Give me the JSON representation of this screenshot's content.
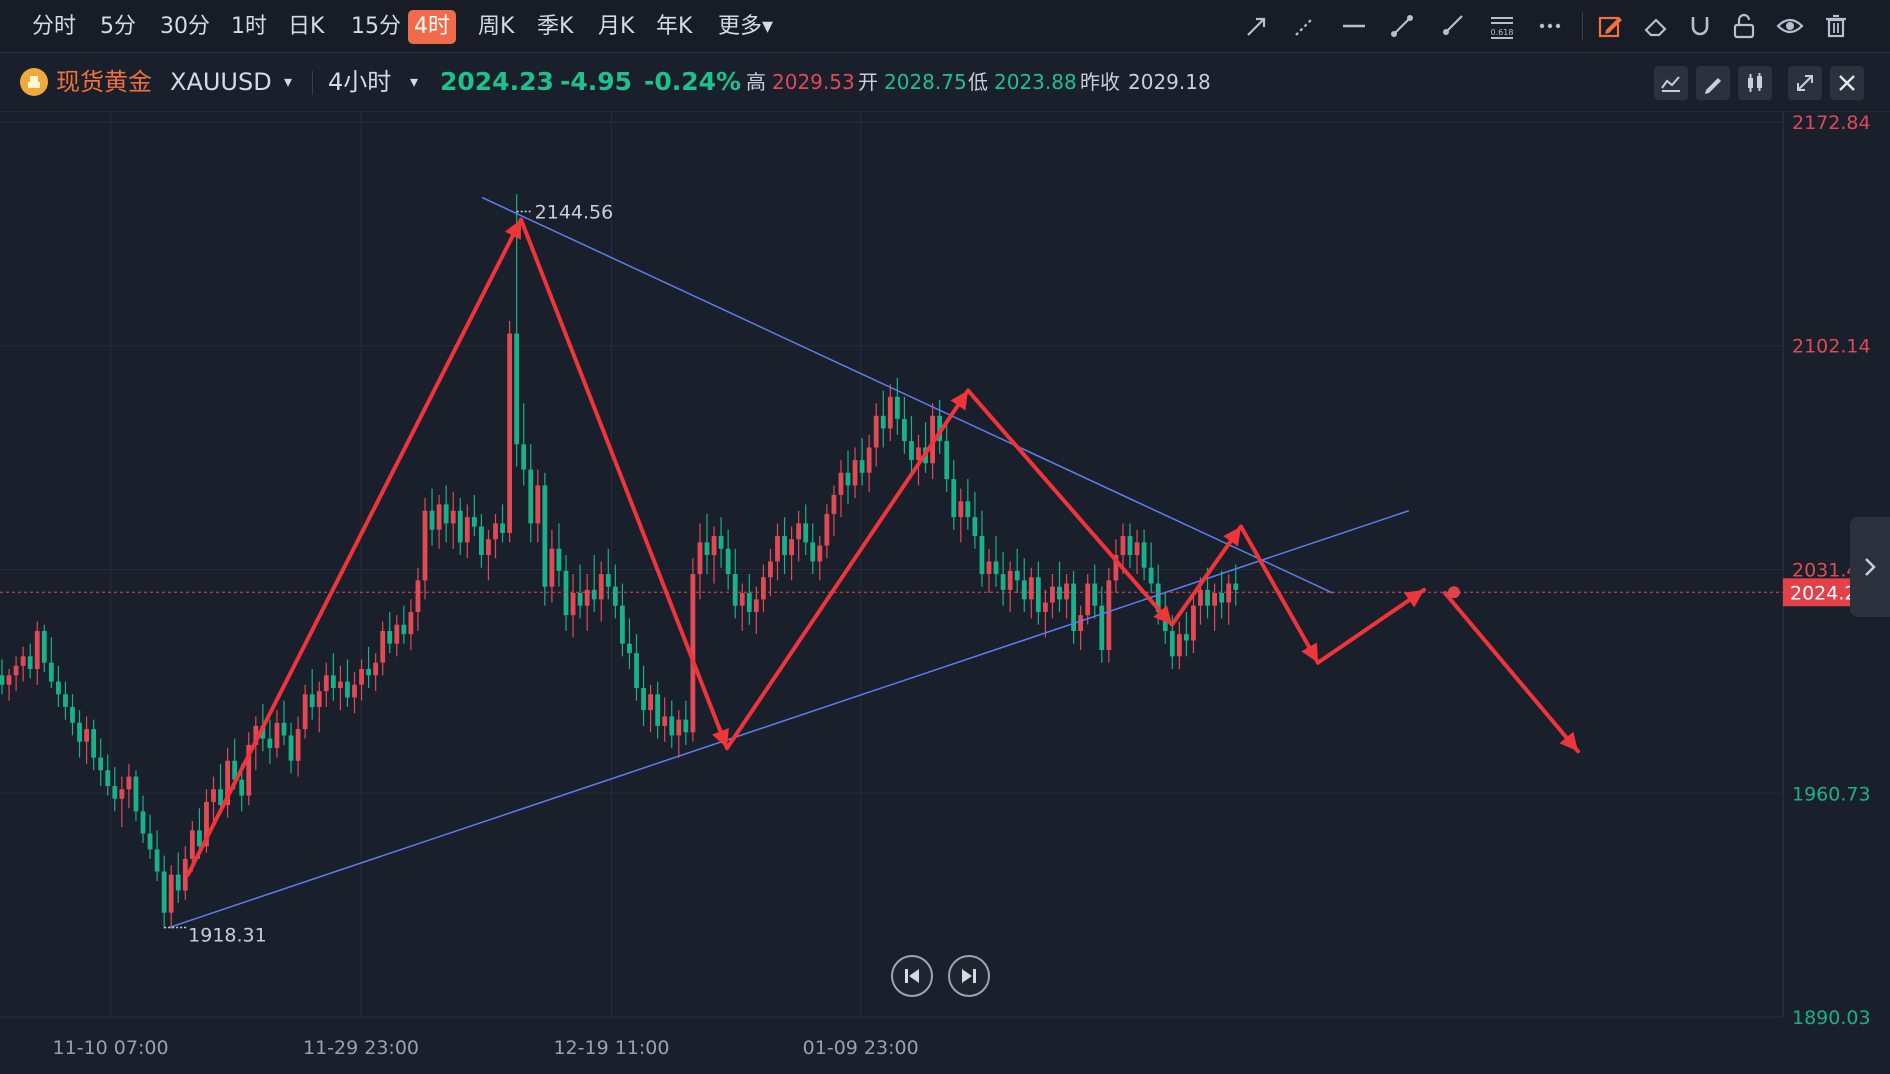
{
  "timeframes": [
    "分时",
    "5分",
    "30分",
    "1时",
    "日K",
    "15分",
    "4时",
    "周K",
    "季K",
    "月K",
    "年K",
    "更多"
  ],
  "active_timeframe": "4时",
  "tool_icons": [
    "arrow-line-icon",
    "dashed-line-icon",
    "horizontal-line-icon",
    "segment-icon",
    "ray-icon",
    "fibonacci-icon",
    "more-dots-icon",
    "edit-icon",
    "eraser-icon",
    "magnet-icon",
    "unlock-icon",
    "eye-icon",
    "trash-icon"
  ],
  "instrument": {
    "name": "现货黄金",
    "symbol": "XAUUSD",
    "period": "4小时",
    "price": "2024.23",
    "change": "-4.95",
    "change_pct": "-0.24%",
    "high_label": "高",
    "high": "2029.53",
    "open_label": "开",
    "open": "2028.75",
    "low_label": "低",
    "low": "2023.88",
    "prev_label": "昨收",
    "prev": "2029.18"
  },
  "colors": {
    "up": "#e04a55",
    "down": "#19b08a",
    "price_green": "#20c08a",
    "arrow": "#f0353a",
    "trendline": "#5d7ef0",
    "bg": "#1a1f2c",
    "grid": "#262c39"
  },
  "chart_data": {
    "type": "candlestick",
    "symbol": "XAUUSD",
    "timeframe": "4H",
    "y_ticks": [
      2172.84,
      2102.14,
      2031.44,
      1960.73,
      1890.03
    ],
    "y_tick_labels": [
      "2172.84",
      "2102.14",
      "2031.44",
      "1960.73",
      "1890.03"
    ],
    "ylim": [
      1890.03,
      2172.84
    ],
    "x_tick_labels": [
      "11-10 07:00",
      "11-29 23:00",
      "12-19 11:00",
      "01-09 23:00"
    ],
    "current_price": 2024.23,
    "current_price_label": "2024.23",
    "annotations": [
      {
        "label": "2144.56",
        "value": 2144.56
      },
      {
        "label": "1918.31",
        "value": 1918.31
      }
    ],
    "trendlines": [
      {
        "name": "upper-resistance",
        "from": [
          0.0,
          2149
        ],
        "to": [
          1.0,
          2024
        ]
      },
      {
        "name": "lower-support",
        "from": [
          0.0,
          1918.3
        ],
        "to": [
          1.0,
          2050
        ]
      }
    ],
    "swing_path": [
      2142,
      1975,
      2088,
      2014,
      2045,
      2002,
      2025
    ],
    "projection": {
      "from": 2024,
      "to": 1974
    },
    "candles": [
      [
        1998,
        2003,
        1992,
        1995
      ],
      [
        1995,
        2000,
        1990,
        1998
      ],
      [
        1998,
        2004,
        1993,
        2001
      ],
      [
        2001,
        2007,
        1996,
        2004
      ],
      [
        2004,
        2008,
        1997,
        2000
      ],
      [
        2000,
        2015,
        1995,
        2012
      ],
      [
        2012,
        2014,
        1999,
        2002
      ],
      [
        2002,
        2010,
        1994,
        1996
      ],
      [
        1996,
        2001,
        1988,
        1992
      ],
      [
        1992,
        1996,
        1984,
        1988
      ],
      [
        1988,
        1992,
        1979,
        1983
      ],
      [
        1983,
        1987,
        1972,
        1977
      ],
      [
        1977,
        1985,
        1970,
        1981
      ],
      [
        1981,
        1984,
        1968,
        1972
      ],
      [
        1972,
        1978,
        1963,
        1968
      ],
      [
        1968,
        1973,
        1960,
        1963
      ],
      [
        1963,
        1969,
        1955,
        1959
      ],
      [
        1959,
        1966,
        1950,
        1962
      ],
      [
        1962,
        1970,
        1956,
        1966
      ],
      [
        1966,
        1968,
        1952,
        1955
      ],
      [
        1955,
        1960,
        1945,
        1948
      ],
      [
        1948,
        1954,
        1940,
        1943
      ],
      [
        1943,
        1949,
        1933,
        1936
      ],
      [
        1936,
        1941,
        1918,
        1923
      ],
      [
        1923,
        1938,
        1918,
        1935
      ],
      [
        1935,
        1942,
        1926,
        1930
      ],
      [
        1930,
        1944,
        1927,
        1940
      ],
      [
        1940,
        1952,
        1936,
        1949
      ],
      [
        1949,
        1956,
        1940,
        1944
      ],
      [
        1944,
        1962,
        1942,
        1958
      ],
      [
        1958,
        1966,
        1952,
        1962
      ],
      [
        1962,
        1970,
        1955,
        1957
      ],
      [
        1957,
        1975,
        1953,
        1971
      ],
      [
        1971,
        1978,
        1962,
        1965
      ],
      [
        1965,
        1970,
        1955,
        1960
      ],
      [
        1960,
        1980,
        1957,
        1976
      ],
      [
        1976,
        1985,
        1968,
        1982
      ],
      [
        1982,
        1989,
        1974,
        1978
      ],
      [
        1978,
        1984,
        1970,
        1975
      ],
      [
        1975,
        1987,
        1972,
        1983
      ],
      [
        1983,
        1990,
        1976,
        1979
      ],
      [
        1979,
        1983,
        1967,
        1971
      ],
      [
        1971,
        1985,
        1966,
        1981
      ],
      [
        1981,
        1995,
        1978,
        1992
      ],
      [
        1992,
        2000,
        1984,
        1988
      ],
      [
        1988,
        1996,
        1980,
        1993
      ],
      [
        1993,
        2002,
        1988,
        1998
      ],
      [
        1998,
        2005,
        1990,
        1994
      ],
      [
        1994,
        2001,
        1987,
        1996
      ],
      [
        1996,
        2003,
        1988,
        1991
      ],
      [
        1991,
        1999,
        1986,
        1995
      ],
      [
        1995,
        2003,
        1990,
        2000
      ],
      [
        2000,
        2007,
        1994,
        1998
      ],
      [
        1998,
        2005,
        1993,
        2002
      ],
      [
        2002,
        2015,
        1998,
        2012
      ],
      [
        2012,
        2018,
        2005,
        2008
      ],
      [
        2008,
        2017,
        2004,
        2014
      ],
      [
        2014,
        2020,
        2008,
        2011
      ],
      [
        2011,
        2022,
        2006,
        2018
      ],
      [
        2018,
        2032,
        2012,
        2028
      ],
      [
        2028,
        2054,
        2022,
        2050
      ],
      [
        2050,
        2057,
        2039,
        2044
      ],
      [
        2044,
        2055,
        2038,
        2052
      ],
      [
        2052,
        2058,
        2040,
        2046
      ],
      [
        2046,
        2056,
        2038,
        2050
      ],
      [
        2050,
        2054,
        2036,
        2040
      ],
      [
        2040,
        2052,
        2035,
        2048
      ],
      [
        2048,
        2055,
        2042,
        2045
      ],
      [
        2045,
        2049,
        2032,
        2036
      ],
      [
        2036,
        2044,
        2028,
        2041
      ],
      [
        2041,
        2049,
        2035,
        2046
      ],
      [
        2046,
        2052,
        2040,
        2043
      ],
      [
        2043,
        2110,
        2040,
        2106
      ],
      [
        2106,
        2150,
        2064,
        2071
      ],
      [
        2071,
        2084,
        2058,
        2063
      ],
      [
        2063,
        2071,
        2040,
        2046
      ],
      [
        2046,
        2063,
        2040,
        2058
      ],
      [
        2058,
        2062,
        2020,
        2026
      ],
      [
        2026,
        2044,
        2021,
        2038
      ],
      [
        2038,
        2046,
        2026,
        2031
      ],
      [
        2031,
        2036,
        2012,
        2017
      ],
      [
        2017,
        2030,
        2010,
        2024
      ],
      [
        2024,
        2033,
        2016,
        2020
      ],
      [
        2020,
        2030,
        2012,
        2025
      ],
      [
        2025,
        2036,
        2018,
        2022
      ],
      [
        2022,
        2034,
        2015,
        2030
      ],
      [
        2030,
        2038,
        2022,
        2026
      ],
      [
        2026,
        2033,
        2016,
        2020
      ],
      [
        2020,
        2027,
        2004,
        2008
      ],
      [
        2008,
        2016,
        2000,
        2005
      ],
      [
        2005,
        2011,
        1990,
        1994
      ],
      [
        1994,
        2001,
        1982,
        1987
      ],
      [
        1987,
        1995,
        1980,
        1992
      ],
      [
        1992,
        1996,
        1978,
        1982
      ],
      [
        1982,
        1991,
        1977,
        1985
      ],
      [
        1985,
        1990,
        1975,
        1979
      ],
      [
        1979,
        1987,
        1972,
        1984
      ],
      [
        1984,
        1990,
        1976,
        1980
      ],
      [
        1980,
        2035,
        1977,
        2030
      ],
      [
        2030,
        2046,
        2022,
        2040
      ],
      [
        2040,
        2049,
        2030,
        2036
      ],
      [
        2036,
        2045,
        2027,
        2042
      ],
      [
        2042,
        2048,
        2032,
        2038
      ],
      [
        2038,
        2044,
        2025,
        2030
      ],
      [
        2030,
        2038,
        2016,
        2020
      ],
      [
        2020,
        2027,
        2012,
        2024
      ],
      [
        2024,
        2030,
        2014,
        2018
      ],
      [
        2018,
        2026,
        2011,
        2022
      ],
      [
        2022,
        2033,
        2018,
        2029
      ],
      [
        2029,
        2038,
        2023,
        2034
      ],
      [
        2034,
        2046,
        2028,
        2042
      ],
      [
        2042,
        2048,
        2030,
        2036
      ],
      [
        2036,
        2045,
        2028,
        2041
      ],
      [
        2041,
        2050,
        2034,
        2046
      ],
      [
        2046,
        2052,
        2036,
        2040
      ],
      [
        2040,
        2046,
        2030,
        2034
      ],
      [
        2034,
        2042,
        2028,
        2039
      ],
      [
        2039,
        2052,
        2035,
        2049
      ],
      [
        2049,
        2058,
        2042,
        2055
      ],
      [
        2055,
        2066,
        2048,
        2062
      ],
      [
        2062,
        2069,
        2052,
        2058
      ],
      [
        2058,
        2070,
        2054,
        2066
      ],
      [
        2066,
        2073,
        2058,
        2062
      ],
      [
        2062,
        2074,
        2056,
        2070
      ],
      [
        2070,
        2084,
        2064,
        2080
      ],
      [
        2080,
        2088,
        2070,
        2076
      ],
      [
        2076,
        2090,
        2072,
        2086
      ],
      [
        2086,
        2092,
        2074,
        2079
      ],
      [
        2079,
        2086,
        2068,
        2072
      ],
      [
        2072,
        2080,
        2062,
        2066
      ],
      [
        2066,
        2074,
        2058,
        2070
      ],
      [
        2070,
        2078,
        2062,
        2065
      ],
      [
        2065,
        2084,
        2060,
        2080
      ],
      [
        2080,
        2085,
        2068,
        2072
      ],
      [
        2072,
        2079,
        2056,
        2060
      ],
      [
        2060,
        2066,
        2044,
        2048
      ],
      [
        2048,
        2057,
        2040,
        2053
      ],
      [
        2053,
        2060,
        2044,
        2048
      ],
      [
        2048,
        2056,
        2038,
        2042
      ],
      [
        2042,
        2050,
        2026,
        2030
      ],
      [
        2030,
        2038,
        2024,
        2034
      ],
      [
        2034,
        2042,
        2026,
        2030
      ],
      [
        2030,
        2037,
        2020,
        2025
      ],
      [
        2025,
        2034,
        2018,
        2031
      ],
      [
        2031,
        2038,
        2024,
        2028
      ],
      [
        2028,
        2035,
        2018,
        2022
      ],
      [
        2022,
        2032,
        2016,
        2029
      ],
      [
        2029,
        2034,
        2014,
        2018
      ],
      [
        2018,
        2025,
        2010,
        2021
      ],
      [
        2021,
        2030,
        2016,
        2026
      ],
      [
        2026,
        2034,
        2018,
        2022
      ],
      [
        2022,
        2030,
        2016,
        2027
      ],
      [
        2027,
        2031,
        2008,
        2012
      ],
      [
        2012,
        2020,
        2006,
        2017
      ],
      [
        2017,
        2030,
        2014,
        2027
      ],
      [
        2027,
        2033,
        2016,
        2020
      ],
      [
        2020,
        2026,
        2002,
        2006
      ],
      [
        2006,
        2032,
        2002,
        2028
      ],
      [
        2028,
        2041,
        2024,
        2036
      ],
      [
        2036,
        2046,
        2030,
        2042
      ],
      [
        2042,
        2046,
        2032,
        2036
      ],
      [
        2036,
        2044,
        2030,
        2040
      ],
      [
        2040,
        2044,
        2028,
        2032
      ],
      [
        2032,
        2040,
        2024,
        2027
      ],
      [
        2027,
        2033,
        2014,
        2018
      ],
      [
        2018,
        2024,
        2008,
        2012
      ],
      [
        2012,
        2017,
        2000,
        2004
      ],
      [
        2004,
        2015,
        2000,
        2011
      ],
      [
        2011,
        2018,
        2004,
        2009
      ],
      [
        2009,
        2023,
        2005,
        2020
      ],
      [
        2020,
        2029,
        2014,
        2025
      ],
      [
        2025,
        2032,
        2016,
        2020
      ],
      [
        2020,
        2027,
        2012,
        2024
      ],
      [
        2024,
        2031,
        2016,
        2021
      ],
      [
        2021,
        2030,
        2014,
        2027
      ],
      [
        2027,
        2033,
        2020,
        2025
      ]
    ]
  }
}
